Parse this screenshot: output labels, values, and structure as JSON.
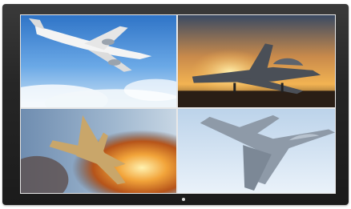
{
  "monitor": {
    "bezel_color": "#262626",
    "tiles": [
      {
        "id": "airliner",
        "subject": "airliner-photo"
      },
      {
        "id": "fighter-sunset",
        "subject": "fighter-jet-sunset-photo"
      },
      {
        "id": "fighter-fire",
        "subject": "fighter-jet-explosion-photo"
      },
      {
        "id": "fighter-sky",
        "subject": "fighter-jet-sky-photo"
      }
    ]
  }
}
